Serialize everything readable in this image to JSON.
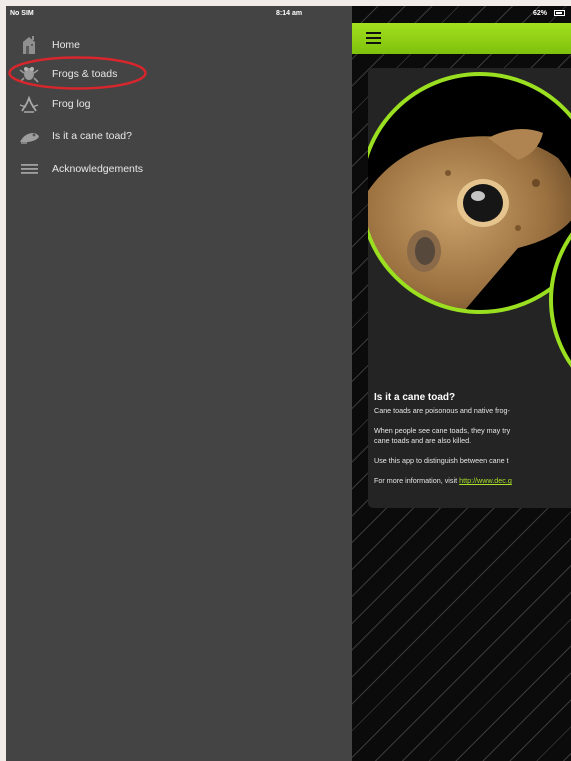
{
  "status_bar": {
    "carrier": "No SIM",
    "time": "8:14 am",
    "battery": "62%"
  },
  "menu": {
    "items": [
      {
        "label": "Home",
        "icon": "house-icon"
      },
      {
        "label": "Frogs & toads",
        "icon": "frog-icon"
      },
      {
        "label": "Frog log",
        "icon": "frog-outline-icon"
      },
      {
        "label": "Is it a cane toad?",
        "icon": "toad-icon"
      },
      {
        "label": "Acknowledgements",
        "icon": "list-icon"
      }
    ],
    "highlighted_item": "Frogs & toads",
    "highlight_color": "#d8262d"
  },
  "toolbar": {
    "menu_icon": "hamburger-icon",
    "accent_color": "#8fd01a"
  },
  "content": {
    "heading": "Is it a cane toad?",
    "paragraph1": "Cane toads are poisonous and native frog-",
    "paragraph2_line1": "When people see cane toads, they may try",
    "paragraph2_line2": "cane toads and are also killed.",
    "paragraph3": "Use this app to distinguish between cane t",
    "paragraph4_prefix": "For more information, visit",
    "paragraph4_link": "http://www.dec.g"
  }
}
